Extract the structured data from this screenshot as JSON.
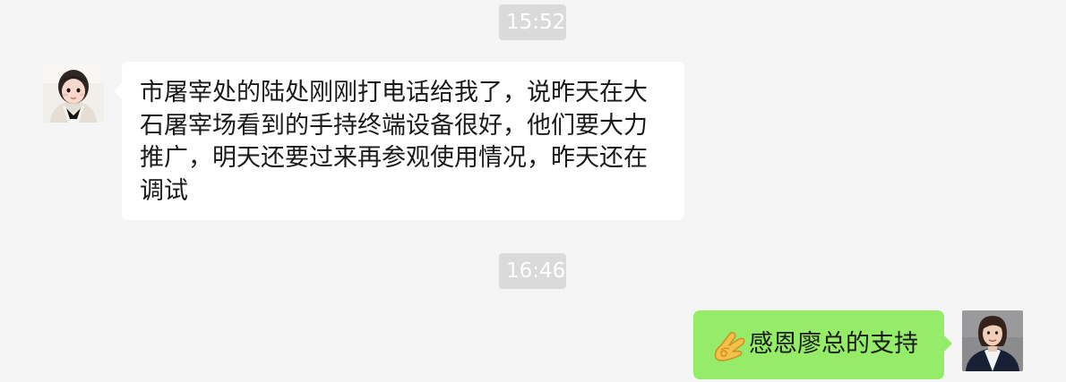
{
  "timestamps": [
    "15:52",
    "16:46"
  ],
  "messages": [
    {
      "side": "incoming",
      "avatar": "child-avatar",
      "text": "市屠宰处的陆处刚刚打电话给我了，说昨天在大石屠宰场看到的手持终端设备很好，他们要大力推广，明天还要过来再参观使用情况，昨天还在调试"
    },
    {
      "side": "outgoing",
      "avatar": "woman-avatar",
      "emoji": "ok-hand-icon",
      "text": "感恩廖总的支持"
    }
  ],
  "colors": {
    "background": "#f5f5f5",
    "incoming_bubble": "#ffffff",
    "outgoing_bubble": "#95ec69",
    "timestamp_pill": "#dadada"
  }
}
